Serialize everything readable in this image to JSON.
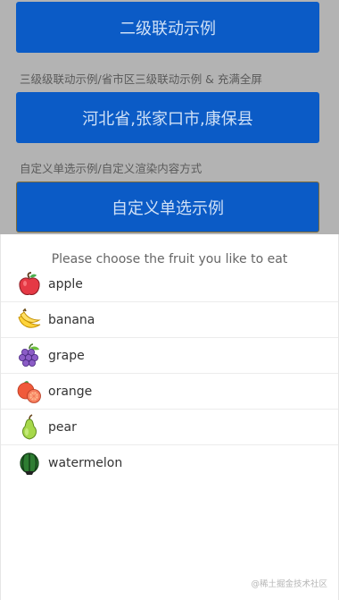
{
  "page": {
    "button_1": "二级联动示例",
    "caption_1": "三级级联动示例/省市区三级联动示例 & 充满全屏",
    "button_2": "河北省,张家口市,康保县",
    "caption_2": "自定义单选示例/自定义渲染内容方式",
    "button_3": "自定义单选示例"
  },
  "sheet": {
    "title": "Please choose the fruit you like to eat",
    "items": [
      {
        "label": "apple",
        "icon": "apple-icon"
      },
      {
        "label": "banana",
        "icon": "banana-icon"
      },
      {
        "label": "grape",
        "icon": "grape-icon"
      },
      {
        "label": "orange",
        "icon": "orange-icon"
      },
      {
        "label": "pear",
        "icon": "pear-icon"
      },
      {
        "label": "watermelon",
        "icon": "watermelon-icon"
      }
    ]
  },
  "watermark": "@稀土掘金技术社区",
  "colors": {
    "button_blue": "#0b5bc6",
    "overlay_gray": "#b3b3b3"
  }
}
